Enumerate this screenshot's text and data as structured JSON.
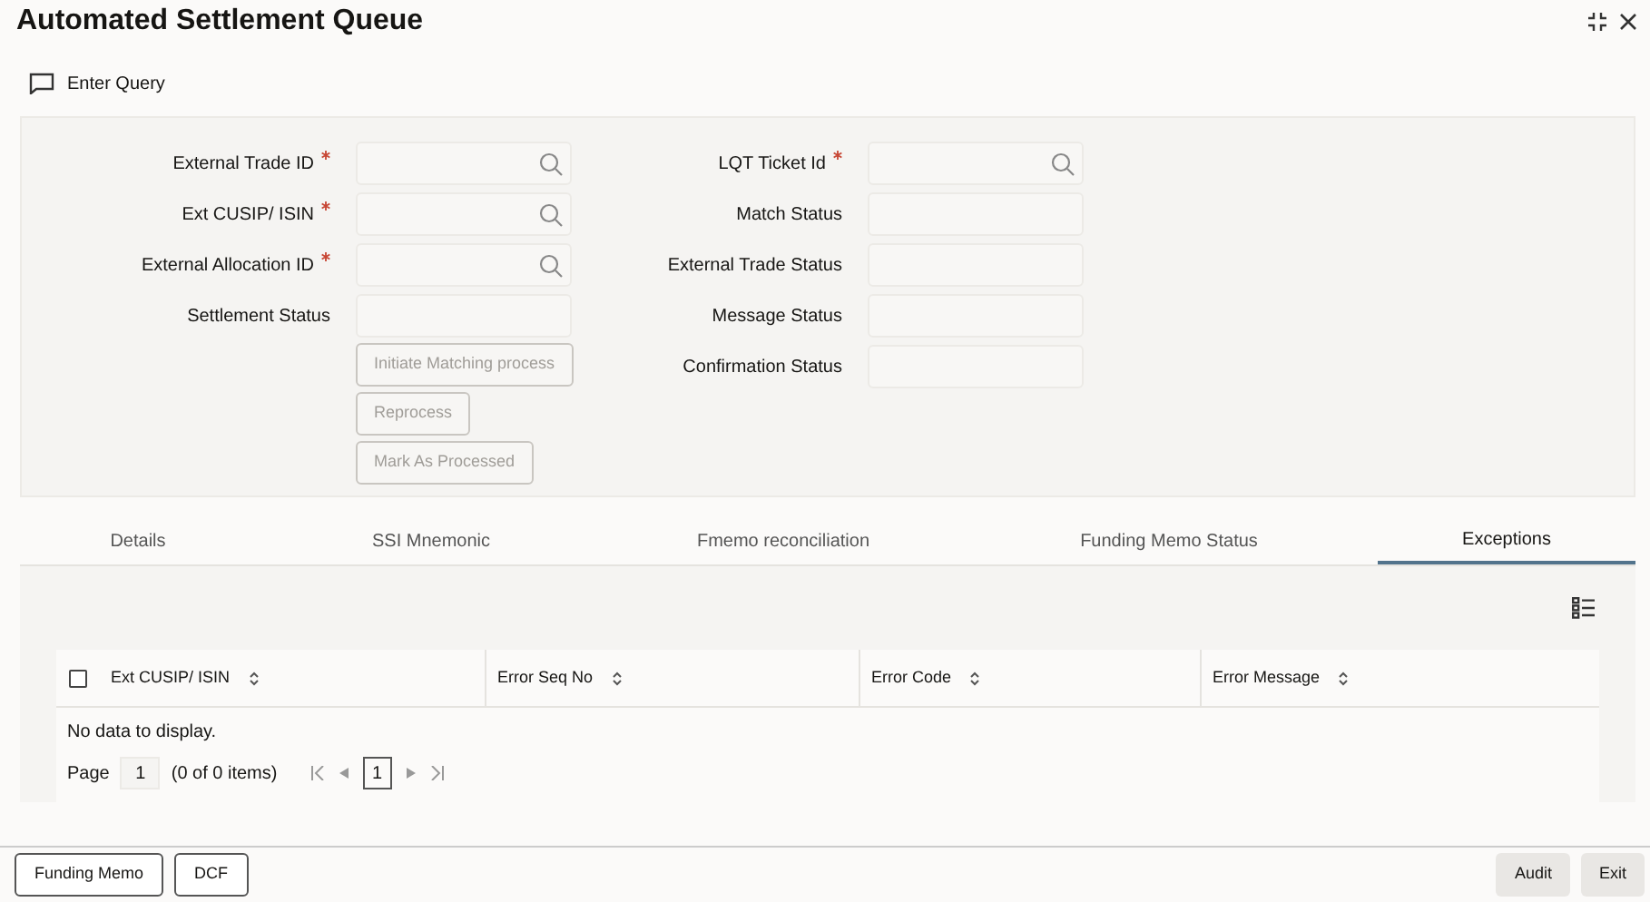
{
  "window": {
    "title": "Automated Settlement Queue"
  },
  "toolbar": {
    "label": "Enter Query"
  },
  "form": {
    "left_fields": [
      {
        "label": "External Trade ID",
        "required": true,
        "lookup": true
      },
      {
        "label": "Ext CUSIP/ ISIN",
        "required": true,
        "lookup": true
      },
      {
        "label": "External Allocation ID",
        "required": true,
        "lookup": true
      },
      {
        "label": "Settlement Status",
        "required": false,
        "lookup": false
      }
    ],
    "buttons": [
      {
        "label": "Initiate Matching process",
        "disabled": true
      },
      {
        "label": "Reprocess",
        "disabled": true
      },
      {
        "label": "Mark As Processed",
        "disabled": true
      }
    ],
    "right_fields": [
      {
        "label": "LQT Ticket Id",
        "required": true,
        "lookup": true
      },
      {
        "label": "Match Status",
        "required": false,
        "lookup": false
      },
      {
        "label": "External Trade Status",
        "required": false,
        "lookup": false
      },
      {
        "label": "Message Status",
        "required": false,
        "lookup": false
      },
      {
        "label": "Confirmation Status",
        "required": false,
        "lookup": false
      }
    ]
  },
  "tabs": [
    {
      "label": "Details",
      "selected": false
    },
    {
      "label": "SSI Mnemonic",
      "selected": false
    },
    {
      "label": "Fmemo reconciliation",
      "selected": false
    },
    {
      "label": "Funding Memo Status",
      "selected": false
    },
    {
      "label": "Exceptions",
      "selected": true
    }
  ],
  "table": {
    "select_all": {
      "checked": false
    },
    "columns": [
      "Ext CUSIP/ ISIN",
      "Error Seq No",
      "Error Code",
      "Error Message"
    ],
    "empty_message": "No data to display.",
    "pagination": {
      "page_label": "Page",
      "page_value": "1",
      "items": "(0 of 0 items)",
      "current_page": "1"
    }
  },
  "footer": {
    "left_buttons": [
      "Funding Memo",
      "DCF"
    ],
    "right_buttons": [
      "Audit",
      "Exit"
    ]
  }
}
